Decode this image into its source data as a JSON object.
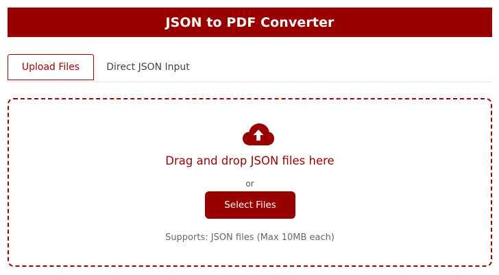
{
  "header": {
    "title": "JSON to PDF Converter"
  },
  "tabs": [
    {
      "label": "Upload Files",
      "active": true
    },
    {
      "label": "Direct JSON Input",
      "active": false
    }
  ],
  "dropzone": {
    "icon": "cloud-upload-icon",
    "title": "Drag and drop JSON files here",
    "or_text": "or",
    "button_label": "Select Files",
    "supports_text": "Supports: JSON files (Max 10MB each)"
  },
  "colors": {
    "accent": "#990000",
    "text_muted": "#666666"
  }
}
